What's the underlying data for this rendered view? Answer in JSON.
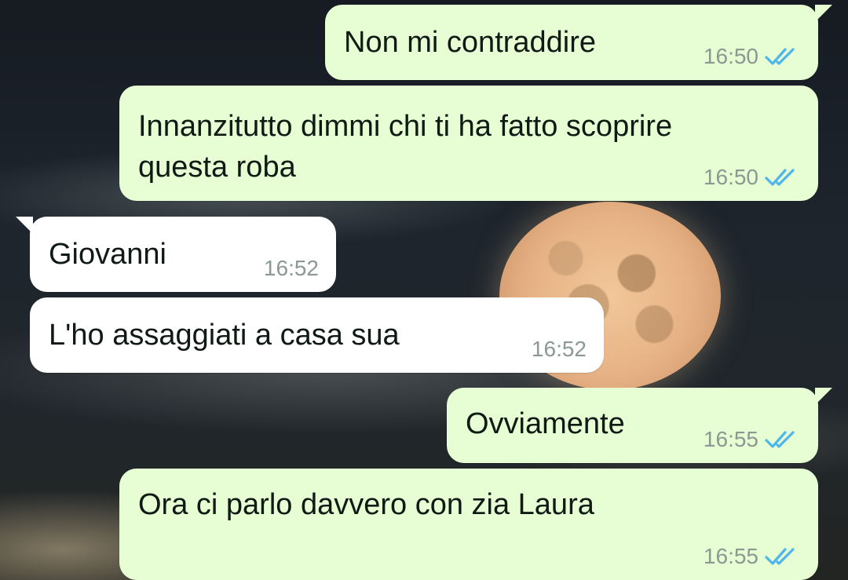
{
  "colors": {
    "outgoing_bubble": "#e7fdd3",
    "incoming_bubble": "#ffffff",
    "read_ticks": "#4fb6ec",
    "timestamp": "#8c9892"
  },
  "messages": [
    {
      "direction": "outgoing",
      "text": "Non mi contraddire",
      "time": "16:50",
      "status_icon": "double-check-read-icon"
    },
    {
      "direction": "outgoing",
      "text": "Innanzitutto dimmi chi ti ha fatto scoprire\nquesta roba",
      "time": "16:50",
      "status_icon": "double-check-read-icon"
    },
    {
      "direction": "incoming",
      "text": "Giovanni",
      "time": "16:52"
    },
    {
      "direction": "incoming",
      "text": "L'ho assaggiati a casa sua",
      "time": "16:52"
    },
    {
      "direction": "outgoing",
      "text": "Ovviamente",
      "time": "16:55",
      "status_icon": "double-check-read-icon"
    },
    {
      "direction": "outgoing",
      "text": "Ora ci parlo davvero con zia Laura",
      "time": "16:55",
      "status_icon": "double-check-read-icon"
    }
  ]
}
